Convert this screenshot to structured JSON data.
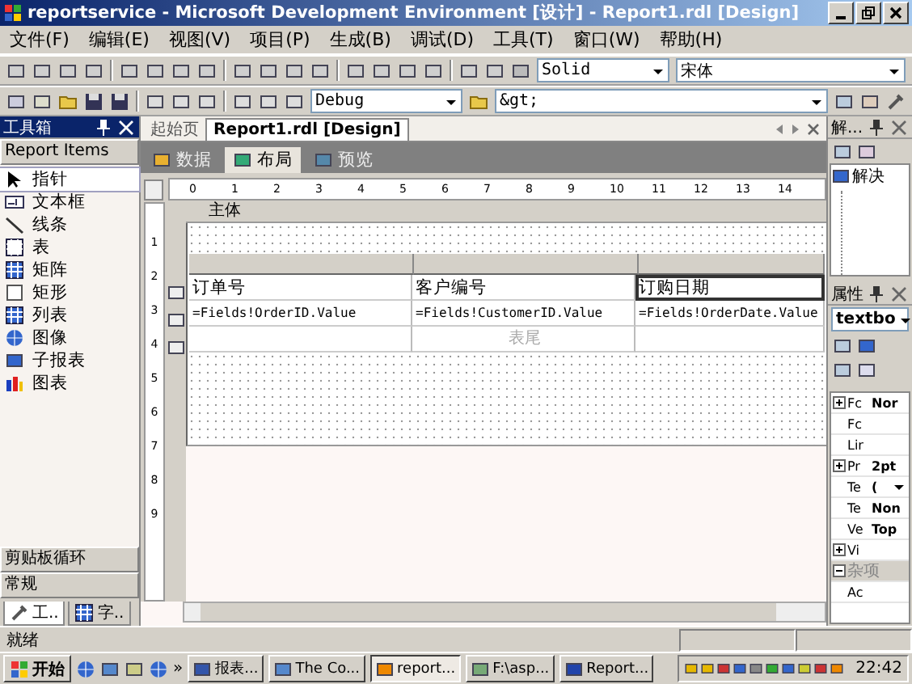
{
  "window": {
    "title": "reportservice - Microsoft Development Environment [设计] - Report1.rdl [Design]"
  },
  "menu": [
    "文件(F)",
    "编辑(E)",
    "视图(V)",
    "项目(P)",
    "生成(B)",
    "调试(D)",
    "工具(T)",
    "窗口(W)",
    "帮助(H)"
  ],
  "toolbar_1": {
    "line_style": "Solid",
    "font": "宋体"
  },
  "toolbar_2": {
    "configuration": "Debug",
    "find": "&gt;"
  },
  "toolbox": {
    "title": "工具箱",
    "section": "Report Items",
    "items": [
      {
        "label": "指针",
        "selected": true
      },
      {
        "label": "文本框",
        "selected": false
      },
      {
        "label": "线条",
        "selected": false
      },
      {
        "label": "表",
        "selected": false
      },
      {
        "label": "矩阵",
        "selected": false
      },
      {
        "label": "矩形",
        "selected": false
      },
      {
        "label": "列表",
        "selected": false
      },
      {
        "label": "图像",
        "selected": false
      },
      {
        "label": "子报表",
        "selected": false
      },
      {
        "label": "图表",
        "selected": false
      }
    ],
    "groups": [
      "剪贴板循环",
      "常规"
    ],
    "tabs": [
      {
        "label": "工..",
        "selected": true
      },
      {
        "label": "字..",
        "selected": false
      }
    ]
  },
  "document_tabs": [
    {
      "label": "起始页",
      "selected": false
    },
    {
      "label": "Report1.rdl [Design]",
      "selected": true
    }
  ],
  "view_tabs": [
    {
      "label": "数据",
      "selected": false
    },
    {
      "label": "布局",
      "selected": true
    },
    {
      "label": "预览",
      "selected": false
    }
  ],
  "ruler": [
    "0",
    "1",
    "2",
    "3",
    "4",
    "5",
    "6",
    "7",
    "8",
    "9",
    "10",
    "11",
    "12",
    "13",
    "14"
  ],
  "vertical_ruler": [
    "1",
    "2",
    "3",
    "4",
    "5",
    "6",
    "7",
    "8",
    "9"
  ],
  "body_label": "主体",
  "table": {
    "rows": [
      {
        "kind": "header",
        "cells": [
          "订单号",
          "客户编号",
          "订购日期"
        ]
      },
      {
        "kind": "detail",
        "cells": [
          "=Fields!OrderID.Value",
          "=Fields!CustomerID.Value",
          "=Fields!OrderDate.Value"
        ]
      },
      {
        "kind": "footer",
        "cells": [
          "表尾"
        ]
      }
    ]
  },
  "solution_explorer": {
    "title": "解...",
    "root": "解决"
  },
  "properties": {
    "title": "属性",
    "object": "textbo",
    "rows": [
      {
        "kind": "group",
        "name": "Fc",
        "value": "Nor"
      },
      {
        "kind": "item",
        "name": "Fc"
      },
      {
        "kind": "item",
        "name": "Lir"
      },
      {
        "kind": "group",
        "name": "Pr",
        "value": "2pt"
      },
      {
        "kind": "dropdown",
        "name": "Te",
        "value": "("
      },
      {
        "kind": "item",
        "name": "Te",
        "value": "Non"
      },
      {
        "kind": "item",
        "name": "Ve",
        "value": "Top"
      },
      {
        "kind": "group",
        "name": "Vi"
      },
      {
        "kind": "category",
        "name": "杂项"
      },
      {
        "kind": "item",
        "name": "Ac"
      }
    ]
  },
  "status_bar": {
    "text": "就绪"
  },
  "taskbar": {
    "start": "开始",
    "more": "»",
    "buttons": [
      {
        "label": "报表...",
        "selected": false
      },
      {
        "label": "The Co...",
        "selected": false
      },
      {
        "label": "report...",
        "selected": true
      },
      {
        "label": "F:\\asp...",
        "selected": false
      },
      {
        "label": "Report...",
        "selected": false
      }
    ],
    "clock": "22:42"
  }
}
